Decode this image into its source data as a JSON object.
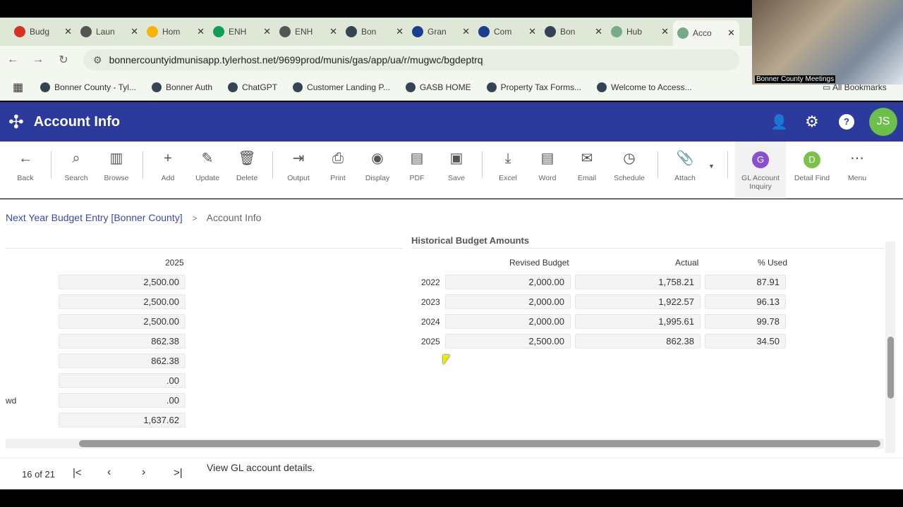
{
  "tabs": [
    {
      "label": "Budg",
      "icon": "gmail-icon",
      "color": "#d93025"
    },
    {
      "label": "Laun",
      "icon": "globe-icon",
      "color": "#555"
    },
    {
      "label": "Hom",
      "icon": "drive-icon",
      "color": "#f4b400"
    },
    {
      "label": "ENH",
      "icon": "sheets-icon",
      "color": "#0f9d58"
    },
    {
      "label": "ENH",
      "icon": "globe-icon",
      "color": "#555"
    },
    {
      "label": "Bon",
      "icon": "county-seal-icon",
      "color": "#345"
    },
    {
      "label": "Gran",
      "icon": "idaho-icon",
      "color": "#1a3d8f"
    },
    {
      "label": "Com",
      "icon": "idaho-icon",
      "color": "#1a3d8f"
    },
    {
      "label": "Bon",
      "icon": "county-seal-icon",
      "color": "#345"
    },
    {
      "label": "Hub",
      "icon": "tyler-icon",
      "color": "#7a8"
    },
    {
      "label": "Acco",
      "icon": "tyler-icon",
      "color": "#7a8"
    }
  ],
  "url": "bonnercountyidmunisapp.tylerhost.net/9699prod/munis/gas/app/ua/r/mugwc/bgdeptrq",
  "bookmarks": [
    "Bonner County - Tyl...",
    "Bonner Auth",
    "ChatGPT",
    "Customer Landing P...",
    "GASB HOME",
    "Property Tax Forms...",
    "Welcome to Access..."
  ],
  "all_bookmarks": "All Bookmarks",
  "video_label": "Bonner County Meetings",
  "header": {
    "title": "Account Info",
    "avatar": "JS"
  },
  "toolbar": [
    "Back",
    "Search",
    "Browse",
    "Add",
    "Update",
    "Delete",
    "Output",
    "Print",
    "Display",
    "PDF",
    "Save",
    "Excel",
    "Word",
    "Email",
    "Schedule",
    "Attach",
    "GL Account Inquiry",
    "Detail Find",
    "Menu"
  ],
  "breadcrumb": {
    "parent": "Next Year Budget Entry [Bonner County]",
    "sep": ">",
    "current": "Account Info"
  },
  "left": {
    "header": "2025",
    "values": [
      "2,500.00",
      "2,500.00",
      "2,500.00",
      "862.38",
      "862.38",
      ".00",
      ".00",
      "1,637.62"
    ],
    "row_label_7": "wd"
  },
  "historical": {
    "title": "Historical Budget Amounts",
    "columns": [
      "Revised Budget",
      "Actual",
      "% Used"
    ],
    "rows": [
      {
        "year": "2022",
        "budget": "2,000.00",
        "actual": "1,758.21",
        "used": "87.91"
      },
      {
        "year": "2023",
        "budget": "2,000.00",
        "actual": "1,922.57",
        "used": "96.13"
      },
      {
        "year": "2024",
        "budget": "2,000.00",
        "actual": "1,995.61",
        "used": "99.78"
      },
      {
        "year": "2025",
        "budget": "2,500.00",
        "actual": "862.38",
        "used": "34.50"
      }
    ]
  },
  "footer": {
    "record": "16 of 21",
    "status": "View GL account details."
  }
}
